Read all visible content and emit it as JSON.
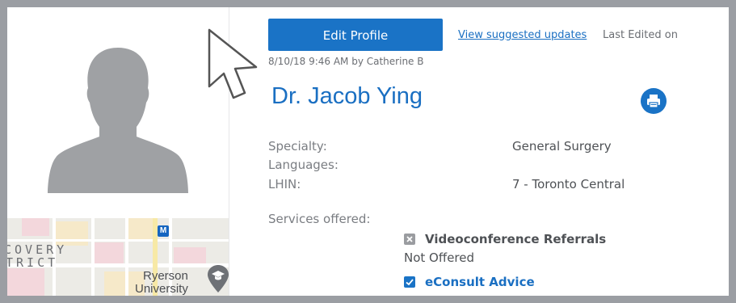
{
  "profile": {
    "edit_button": "Edit Profile",
    "suggested_updates_link": "View suggested updates",
    "last_edited_label": "Last Edited on",
    "edited_by": "8/10/18 9:46 AM by Catherine B",
    "name": "Dr. Jacob Ying"
  },
  "details": {
    "specialty_label": "Specialty:",
    "specialty_value": "General Surgery",
    "languages_label": "Languages:",
    "lhin_label": "LHIN:",
    "lhin_value": "7 - Toronto Central",
    "services_label": "Services offered:"
  },
  "services": [
    {
      "name": "Videoconference Referrals",
      "status": "Not Offered",
      "checked": false
    },
    {
      "name": "eConsult Advice",
      "checked": true
    }
  ],
  "map": {
    "district_line1": "COVERY",
    "district_line2": "TRICT",
    "university_line1": "Ryerson",
    "university_line2": "University",
    "metro_letter": "M"
  },
  "icons": {
    "print": "printer-icon",
    "avatar": "person-silhouette-icon",
    "checkbox_off": "x-square-icon",
    "checkbox_on": "checkmark-square-icon",
    "cursor": "mouse-pointer-icon",
    "map_pin": "graduation-cap-pin-icon"
  },
  "colors": {
    "accent": "#1a73c6",
    "link": "#1a6fc2",
    "muted_text": "#7a7d82",
    "frame": "#9b9ea3"
  }
}
